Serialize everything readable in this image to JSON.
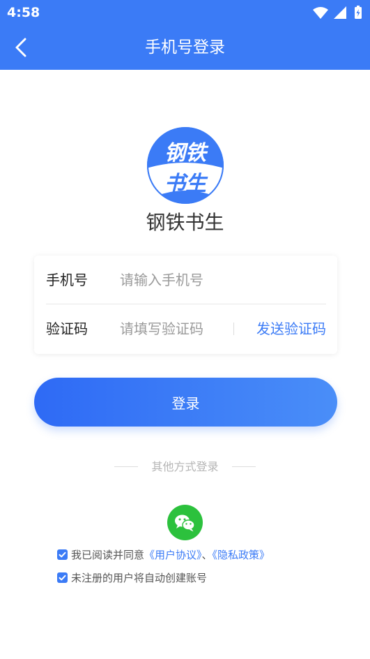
{
  "status_bar": {
    "time": "4:58",
    "icons": [
      "wifi-icon",
      "signal-icon",
      "battery-icon"
    ]
  },
  "header": {
    "title": "手机号登录",
    "back_icon": "chevron-left-icon"
  },
  "logo": {
    "text_line1": "钢铁",
    "text_line2": "书生"
  },
  "app_name": "钢铁书生",
  "form": {
    "phone_label": "手机号",
    "phone_placeholder": "请输入手机号",
    "phone_value": "",
    "code_label": "验证码",
    "code_placeholder": "请填写验证码",
    "code_value": "",
    "send_code_label": "发送验证码"
  },
  "login_button": "登录",
  "other_login": {
    "label": "其他方式登录",
    "wechat_icon": "wechat-icon"
  },
  "agreements": {
    "line1_prefix": "我已阅读并同意",
    "user_agreement": "《用户协议》",
    "separator": "、",
    "privacy_policy": "《隐私政策》",
    "line2": "未注册的用户将自动创建账号",
    "line1_checked": true,
    "line2_checked": true
  },
  "colors": {
    "primary": "#3b7bf6",
    "wechat": "#2cc13d",
    "placeholder": "#9a9a9a"
  }
}
